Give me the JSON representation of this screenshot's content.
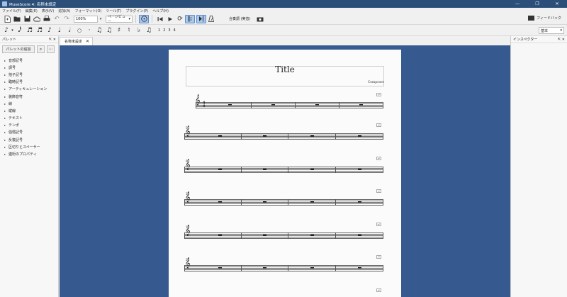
{
  "window": {
    "title": "MuseScore 4: 名称未設定",
    "controls": [
      "—",
      "❐",
      "✕"
    ]
  },
  "menu": [
    "ファイル(F)",
    "編集(E)",
    "表示(V)",
    "追加(A)",
    "フォーマット(O)",
    "ツール(T)",
    "プラグイン(P)",
    "ヘルプ(H)"
  ],
  "toolbar": {
    "zoom_value": "100%",
    "view_mode": "ページビュー",
    "concert_pitch_label": "合奏調 (実音)",
    "feedback_label": "フィードバック"
  },
  "note_input": {
    "voices": [
      "1",
      "2",
      "3",
      "4"
    ],
    "workspace": "基本"
  },
  "palettes": {
    "header": "パレット",
    "add_button": "パレットの追加",
    "items": [
      "音部記号",
      "調号",
      "拍子記号",
      "臨時記号",
      "アーティキュレーション",
      "装飾音符",
      "線",
      "縦線",
      "テキスト",
      "テンポ",
      "強弱記号",
      "反復記号",
      "区切りとスペーサー",
      "連桁のプロパティ"
    ]
  },
  "inspector": {
    "header": "インスペクター"
  },
  "document_tab": {
    "label": "名称未設定"
  },
  "score": {
    "title": "Title",
    "composer": "Composer",
    "time_signature": [
      "4",
      "4"
    ],
    "measure_numbers": [
      "5",
      "9",
      "13",
      "17",
      "21"
    ]
  }
}
